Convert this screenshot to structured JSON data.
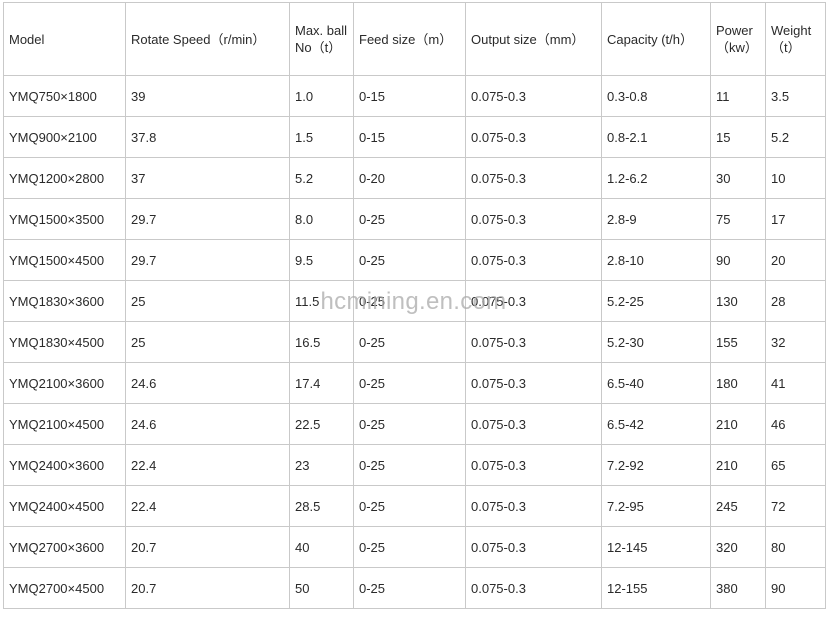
{
  "table": {
    "headers": [
      {
        "key": "model",
        "label": "Model"
      },
      {
        "key": "speed",
        "label": "Rotate Speed（r/min）"
      },
      {
        "key": "ball",
        "label": "Max. ball No（t）"
      },
      {
        "key": "feed",
        "label": "Feed size（m）"
      },
      {
        "key": "output",
        "label": "Output size（mm）"
      },
      {
        "key": "capacity",
        "label": "Capacity (t/h）"
      },
      {
        "key": "power",
        "label": "Power（kw）"
      },
      {
        "key": "weight",
        "label": "Weight（t）"
      }
    ],
    "rows": [
      [
        "YMQ750×1800",
        "39",
        "1.0",
        "0-15",
        "0.075-0.3",
        "0.3-0.8",
        "11",
        "3.5"
      ],
      [
        "YMQ900×2100",
        "37.8",
        "1.5",
        "0-15",
        "0.075-0.3",
        "0.8-2.1",
        "15",
        "5.2"
      ],
      [
        "YMQ1200×2800",
        "37",
        "5.2",
        "0-20",
        "0.075-0.3",
        "1.2-6.2",
        "30",
        "10"
      ],
      [
        "YMQ1500×3500",
        "29.7",
        "8.0",
        "0-25",
        "0.075-0.3",
        "2.8-9",
        "75",
        "17"
      ],
      [
        "YMQ1500×4500",
        "29.7",
        "9.5",
        "0-25",
        "0.075-0.3",
        "2.8-10",
        "90",
        "20"
      ],
      [
        "YMQ1830×3600",
        "25",
        "11.5",
        "0-25",
        "0.075-0.3",
        "5.2-25",
        "130",
        "28"
      ],
      [
        "YMQ1830×4500",
        "25",
        "16.5",
        "0-25",
        "0.075-0.3",
        "5.2-30",
        "155",
        "32"
      ],
      [
        "YMQ2100×3600",
        "24.6",
        "17.4",
        "0-25",
        "0.075-0.3",
        "6.5-40",
        "180",
        "41"
      ],
      [
        "YMQ2100×4500",
        "24.6",
        "22.5",
        "0-25",
        "0.075-0.3",
        "6.5-42",
        "210",
        "46"
      ],
      [
        "YMQ2400×3600",
        "22.4",
        "23",
        "0-25",
        "0.075-0.3",
        "7.2-92",
        "210",
        "65"
      ],
      [
        "YMQ2400×4500",
        "22.4",
        "28.5",
        "0-25",
        "0.075-0.3",
        "7.2-95",
        "245",
        "72"
      ],
      [
        "YMQ2700×3600",
        "20.7",
        "40",
        "0-25",
        "0.075-0.3",
        "12-145",
        "320",
        "80"
      ],
      [
        "YMQ2700×4500",
        "20.7",
        "50",
        "0-25",
        "0.075-0.3",
        "12-155",
        "380",
        "90"
      ]
    ]
  },
  "watermark": {
    "text": "hcmining.en.com"
  },
  "colors": {
    "border": "#c9c9c9",
    "text": "#2a2a2a",
    "watermark": "#aaaaaa"
  }
}
